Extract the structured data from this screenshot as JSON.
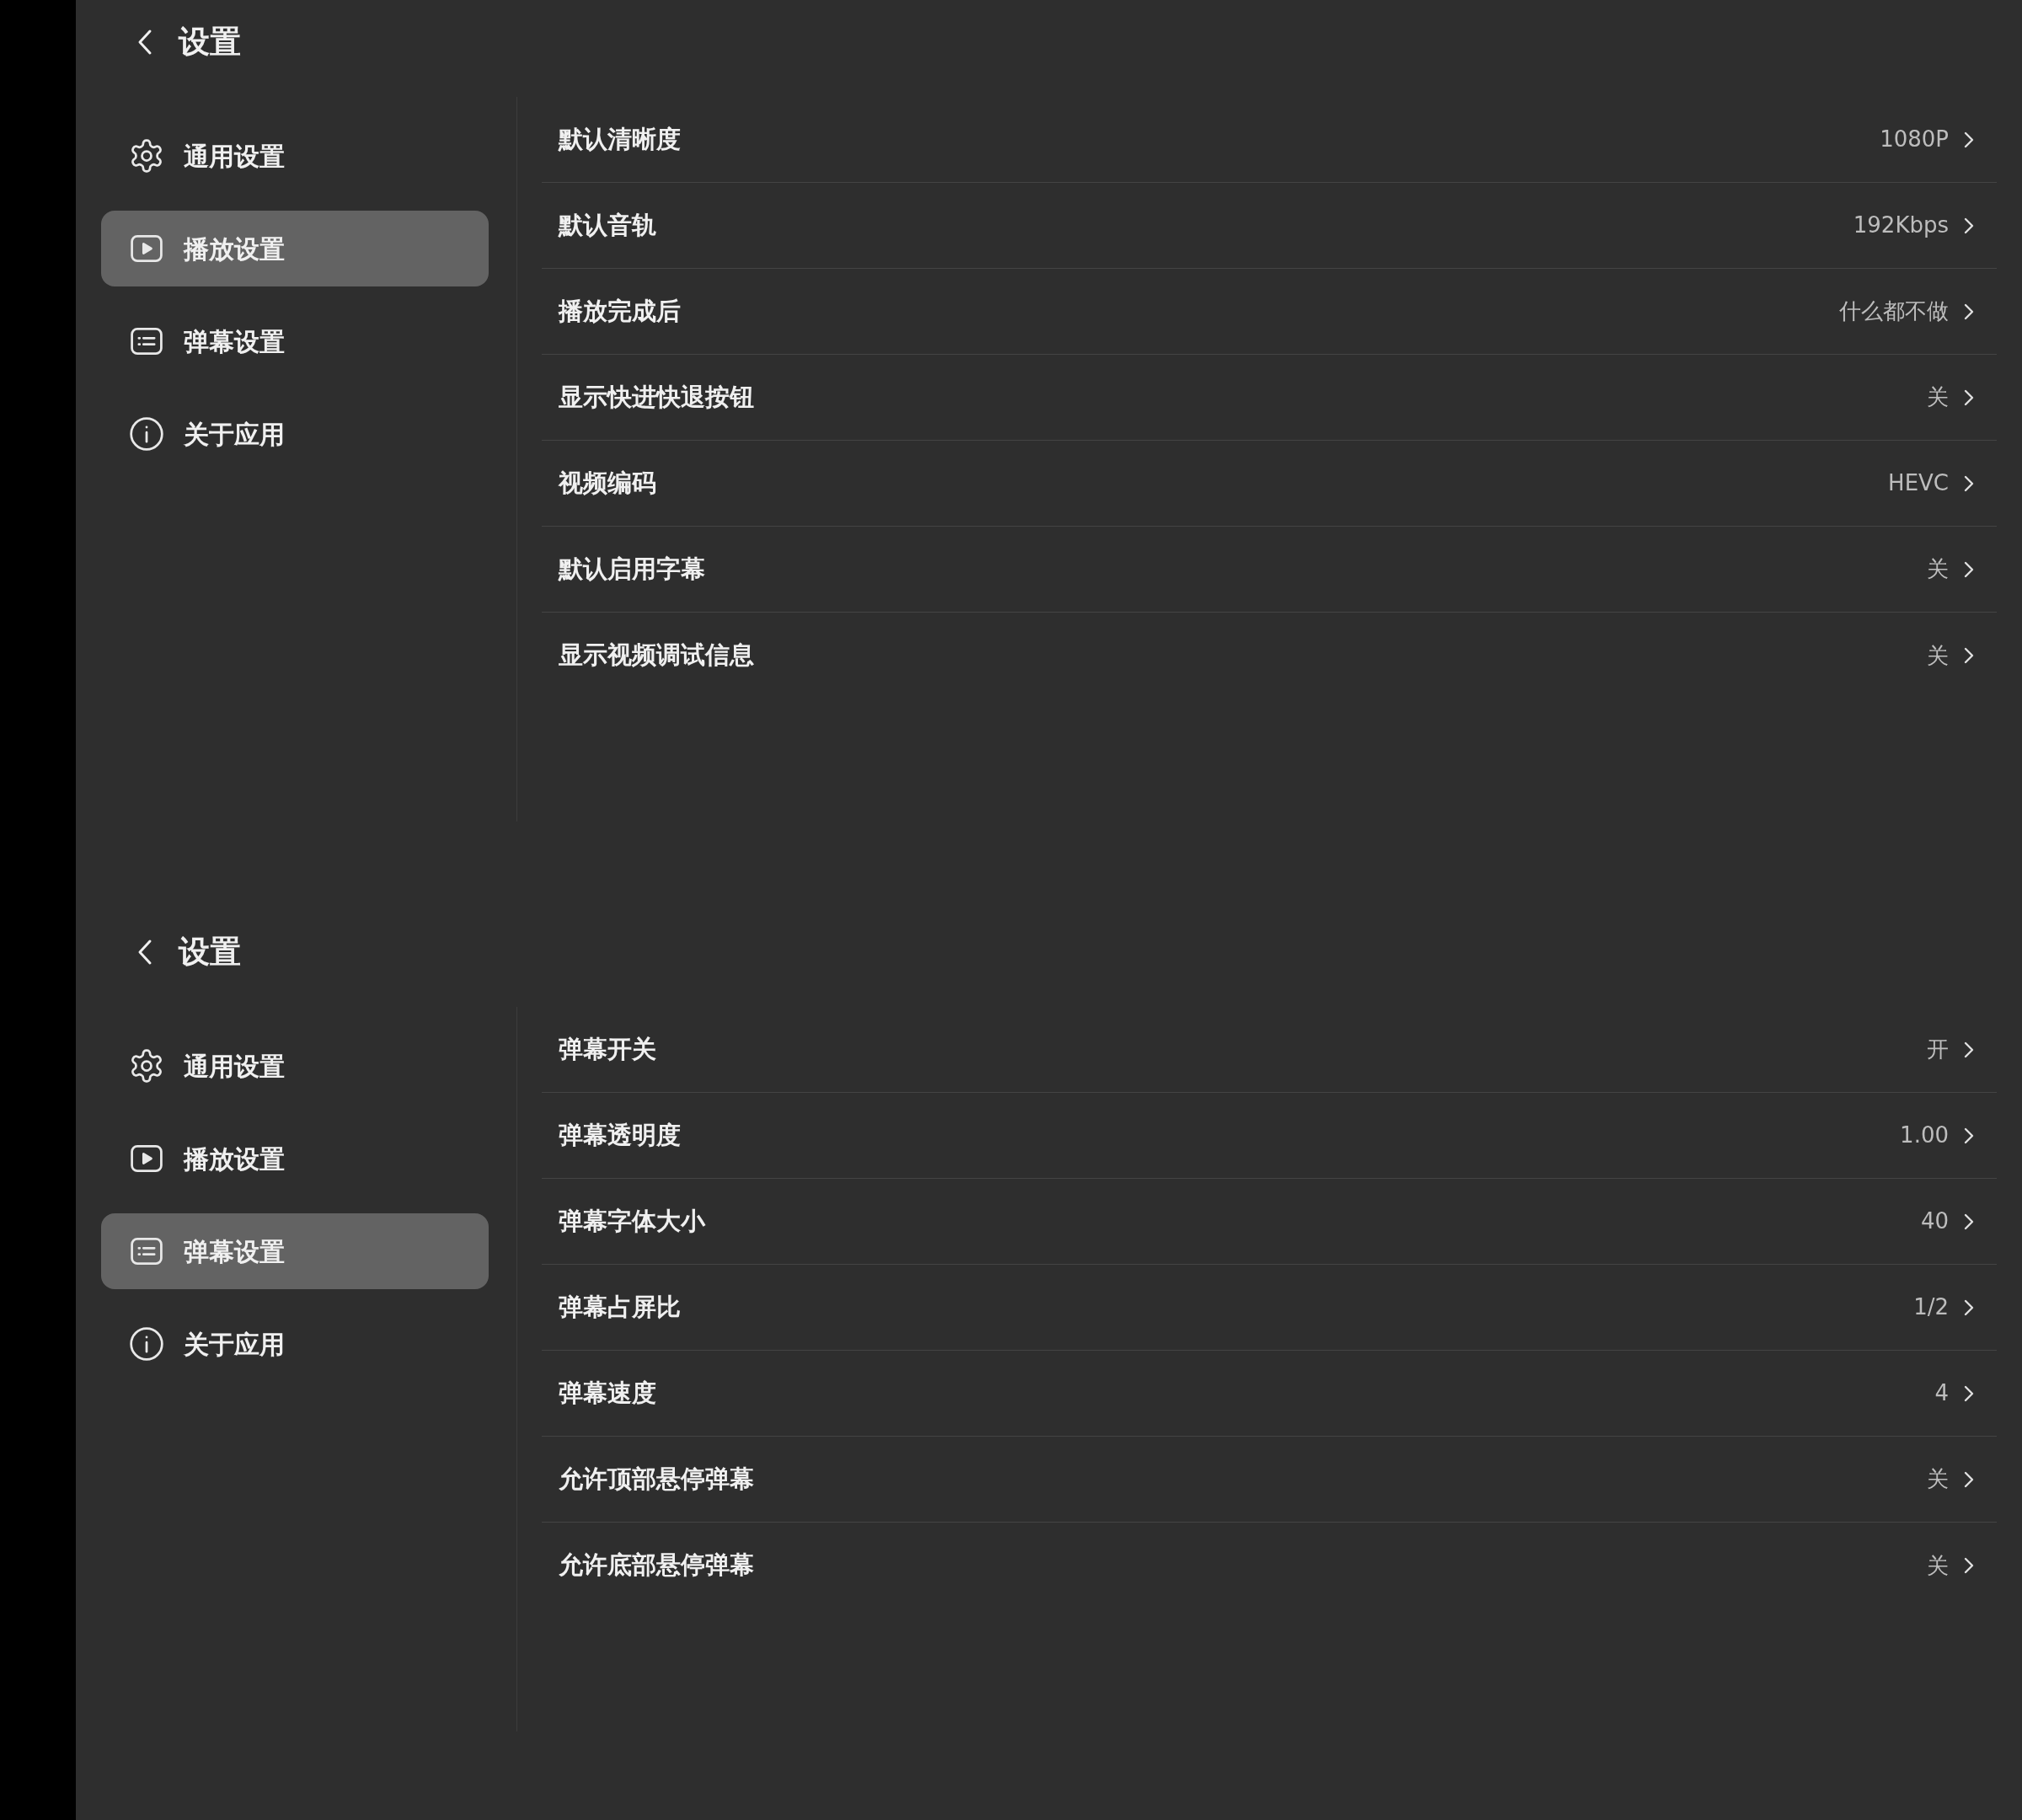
{
  "panels": [
    {
      "title": "设置",
      "menu": [
        {
          "label": "通用设置",
          "selected": false
        },
        {
          "label": "播放设置",
          "selected": true
        },
        {
          "label": "弹幕设置",
          "selected": false
        },
        {
          "label": "关于应用",
          "selected": false
        }
      ],
      "settings": [
        {
          "label": "默认清晰度",
          "value": "1080P"
        },
        {
          "label": "默认音轨",
          "value": "192Kbps"
        },
        {
          "label": "播放完成后",
          "value": "什么都不做"
        },
        {
          "label": "显示快进快退按钮",
          "value": "关"
        },
        {
          "label": "视频编码",
          "value": "HEVC"
        },
        {
          "label": "默认启用字幕",
          "value": "关"
        },
        {
          "label": "显示视频调试信息",
          "value": "关"
        }
      ]
    },
    {
      "title": "设置",
      "menu": [
        {
          "label": "通用设置",
          "selected": false
        },
        {
          "label": "播放设置",
          "selected": false
        },
        {
          "label": "弹幕设置",
          "selected": true
        },
        {
          "label": "关于应用",
          "selected": false
        }
      ],
      "settings": [
        {
          "label": "弹幕开关",
          "value": "开"
        },
        {
          "label": "弹幕透明度",
          "value": "1.00"
        },
        {
          "label": "弹幕字体大小",
          "value": "40"
        },
        {
          "label": "弹幕占屏比",
          "value": "1/2"
        },
        {
          "label": "弹幕速度",
          "value": "4"
        },
        {
          "label": "允许顶部悬停弹幕",
          "value": "关"
        },
        {
          "label": "允许底部悬停弹幕",
          "value": "关"
        }
      ]
    }
  ]
}
